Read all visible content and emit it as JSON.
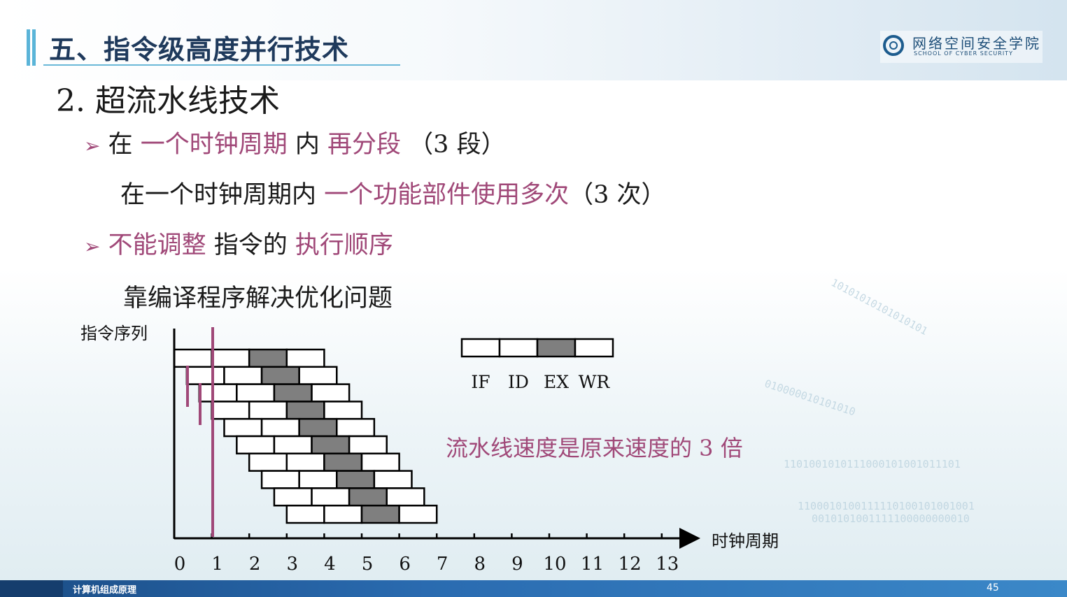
{
  "header": {
    "title": "五、指令级高度并行技术",
    "logo_cn": "网络空间安全学院",
    "logo_en": "SCHOOL OF CYBER SECURITY"
  },
  "content": {
    "heading": "2. 超流水线技术",
    "bullet1": {
      "prefix": "在 ",
      "hl1": "一个时钟周期",
      "mid": " 内 ",
      "hl2": "再分段",
      "suffix": " （3 段）"
    },
    "line2": {
      "prefix": "在一个时钟周期内 ",
      "hl": "一个功能部件使用多次",
      "suffix": "（3 次）"
    },
    "bullet2": {
      "hl1": "不能调整",
      "mid": " 指令的 ",
      "hl2": "执行顺序"
    },
    "line4": "靠编译程序解决优化问题"
  },
  "diagram": {
    "y_axis_label": "指令序列",
    "x_axis_label": "时钟周期",
    "x_ticks": [
      "0",
      "1",
      "2",
      "3",
      "4",
      "5",
      "6",
      "7",
      "8",
      "9",
      "10",
      "11",
      "12",
      "13"
    ],
    "legend_stages": [
      "IF",
      "ID",
      "EX",
      "WR"
    ],
    "note": "流水线速度是原来速度的 3 倍",
    "instruction_count": 10,
    "stages_per_instruction": 4,
    "stage_colors": {
      "normal": "#ffffff",
      "EX": "#7f7f7f"
    },
    "highlight_color": "#a04878"
  },
  "footer": {
    "course": "计算机组成原理",
    "page_number": "45"
  }
}
